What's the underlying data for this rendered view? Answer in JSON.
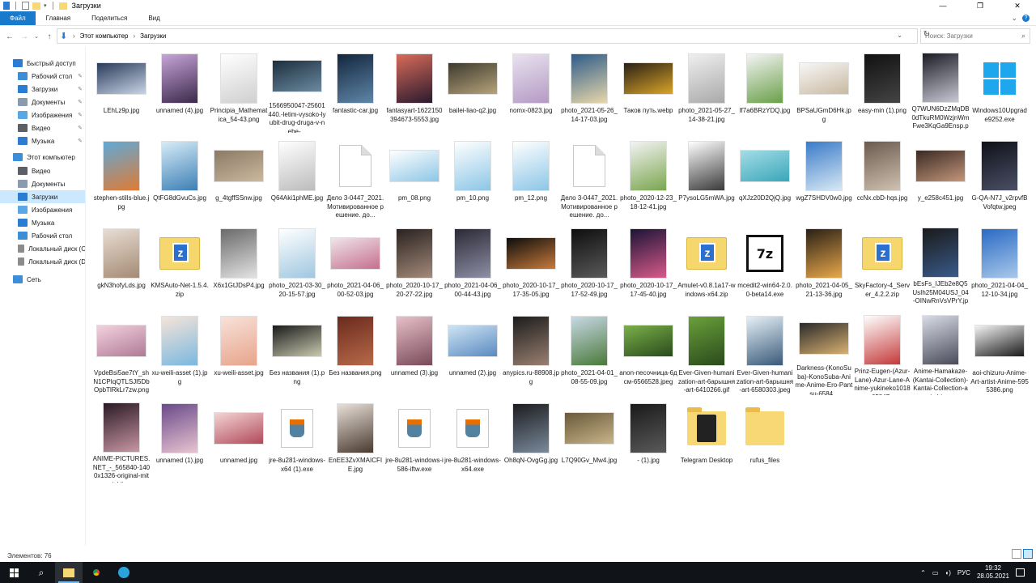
{
  "window": {
    "title": "Загрузки",
    "minimize": "—",
    "maximize": "❐",
    "close": "✕"
  },
  "ribbon": {
    "tabs": [
      "Файл",
      "Главная",
      "Поделиться",
      "Вид"
    ]
  },
  "address": {
    "crumbs": [
      "Этот компьютер",
      "Загрузки"
    ],
    "search_placeholder": "Поиск: Загрузки"
  },
  "nav": {
    "items": [
      {
        "label": "Быстрый доступ",
        "icon": "star-icon",
        "color": "#2b7cd3",
        "indent": 0,
        "pin": false
      },
      {
        "label": "Рабочий стол",
        "icon": "desktop-icon",
        "color": "#3c8fd6",
        "indent": 1,
        "pin": true
      },
      {
        "label": "Загрузки",
        "icon": "download-icon",
        "color": "#2b7cd3",
        "indent": 1,
        "pin": true
      },
      {
        "label": "Документы",
        "icon": "documents-icon",
        "color": "#8a9bb0",
        "indent": 1,
        "pin": true
      },
      {
        "label": "Изображения",
        "icon": "pictures-icon",
        "color": "#5aa7e6",
        "indent": 1,
        "pin": true
      },
      {
        "label": "Видео",
        "icon": "video-icon",
        "color": "#5b5f66",
        "indent": 1,
        "pin": true
      },
      {
        "label": "Музыка",
        "icon": "music-icon",
        "color": "#2b7cd3",
        "indent": 1,
        "pin": true
      },
      {
        "label": "Этот компьютер",
        "icon": "computer-icon",
        "color": "#3c8fd6",
        "indent": 0,
        "pin": false
      },
      {
        "label": "Видео",
        "icon": "video-icon",
        "color": "#5b5f66",
        "indent": 1,
        "pin": false
      },
      {
        "label": "Документы",
        "icon": "documents-icon",
        "color": "#8a9bb0",
        "indent": 1,
        "pin": false
      },
      {
        "label": "Загрузки",
        "icon": "download-icon",
        "color": "#2b7cd3",
        "indent": 1,
        "pin": false
      },
      {
        "label": "Изображения",
        "icon": "pictures-icon",
        "color": "#5aa7e6",
        "indent": 1,
        "pin": false
      },
      {
        "label": "Музыка",
        "icon": "music-icon",
        "color": "#2b7cd3",
        "indent": 1,
        "pin": false
      },
      {
        "label": "Рабочий стол",
        "icon": "desktop-icon",
        "color": "#3c8fd6",
        "indent": 1,
        "pin": false
      },
      {
        "label": "Локальный диск (C",
        "icon": "drive-icon",
        "color": "#8c8c8c",
        "indent": 1,
        "pin": false
      },
      {
        "label": "Локальный диск (D",
        "icon": "drive-icon",
        "color": "#8c8c8c",
        "indent": 1,
        "pin": false
      },
      {
        "label": "Сеть",
        "icon": "network-icon",
        "color": "#3c8fd6",
        "indent": 0,
        "pin": false
      }
    ],
    "selected_index": 10
  },
  "files": [
    {
      "name": "LEhLz9p.jpg",
      "kind": "img",
      "c1": "#2a3a5a",
      "c2": "#c8d4e6"
    },
    {
      "name": "unnamed (4).jpg",
      "kind": "img",
      "c1": "#c7a4d8",
      "c2": "#3b2a4a"
    },
    {
      "name": "Principia_Mathematica_54-43.png",
      "kind": "img",
      "c1": "#ffffff",
      "c2": "#cfcfcf"
    },
    {
      "name": "1566950047-25601440.-letim-vysoko-lyubit-drug-druga-v-nebe-...",
      "kind": "img",
      "c1": "#1c2f3e",
      "c2": "#6b8aa0"
    },
    {
      "name": "fantastic-car.jpg",
      "kind": "img",
      "c1": "#13263d",
      "c2": "#5f86a8"
    },
    {
      "name": "fantasyart-1622150394673-5553.jpg",
      "kind": "img",
      "c1": "#d96b5a",
      "c2": "#2a1a2e"
    },
    {
      "name": "bailei-liao-q2.jpg",
      "kind": "img",
      "c1": "#3c3a2e",
      "c2": "#b7a37a"
    },
    {
      "name": "nomx-0823.jpg",
      "kind": "img",
      "c1": "#e9e2ef",
      "c2": "#b49ac4"
    },
    {
      "name": "photo_2021-05-26_14-17-03.jpg",
      "kind": "img",
      "c1": "#2d5c8a",
      "c2": "#e8d7a9"
    },
    {
      "name": "Таков путь.webp",
      "kind": "img",
      "c1": "#2a2014",
      "c2": "#d9a42a"
    },
    {
      "name": "photo_2021-05-27_14-38-21.jpg",
      "kind": "img",
      "c1": "#efefef",
      "c2": "#a9a9a9"
    },
    {
      "name": "lf7a6BRzYDQ.jpg",
      "kind": "img",
      "c1": "#f4f4f4",
      "c2": "#6aa04a"
    },
    {
      "name": "BPSaUGmD6Hk.jpg",
      "kind": "img",
      "c1": "#f7f7f7",
      "c2": "#c9b9a0"
    },
    {
      "name": "easy-min (1).png",
      "kind": "img",
      "c1": "#111111",
      "c2": "#444444"
    },
    {
      "name": "Q7WUN6DzZMqDB0dTkuRM0WzjnWmFwe3KqGa9Ensp.png",
      "kind": "img",
      "c1": "#1b1b24",
      "c2": "#c9c9d6"
    },
    {
      "name": "Windows10Upgrade9252.exe",
      "kind": "win"
    },
    {
      "name": "stephen-stills-blue.jpg",
      "kind": "img",
      "c1": "#5fa9d8",
      "c2": "#e07b34"
    },
    {
      "name": "QtFG8dGvuCs.jpg",
      "kind": "img",
      "c1": "#d7ecf7",
      "c2": "#3c7fb5"
    },
    {
      "name": "g_4tgffSSnw.jpg",
      "kind": "img",
      "c1": "#8a7a66",
      "c2": "#cbb89e"
    },
    {
      "name": "Q64Aki1phME.jpg",
      "kind": "img",
      "c1": "#ffffff",
      "c2": "#bcbcbc"
    },
    {
      "name": "Дело 3-0447_2021. Мотивированное решение. до...",
      "kind": "doc"
    },
    {
      "name": "pm_08.png",
      "kind": "img",
      "c1": "#ffffff",
      "c2": "#8cc6e6"
    },
    {
      "name": "pm_10.png",
      "kind": "img",
      "c1": "#ffffff",
      "c2": "#8cc6e6"
    },
    {
      "name": "pm_12.png",
      "kind": "img",
      "c1": "#ffffff",
      "c2": "#8cc6e6"
    },
    {
      "name": "Дело 3-0447_2021. Мотивированное решение. до...",
      "kind": "doc"
    },
    {
      "name": "photo_2020-12-23_18-12-41.jpg",
      "kind": "img",
      "c1": "#f3f3f3",
      "c2": "#7aa64f"
    },
    {
      "name": "P7ysoLG5mWA.jpg",
      "kind": "img",
      "c1": "#ffffff",
      "c2": "#3a3a3a"
    },
    {
      "name": "qXJz20D2QjQ.jpg",
      "kind": "img",
      "c1": "#a3dde7",
      "c2": "#3aa6b8"
    },
    {
      "name": "wgZ7SHDV0w0.jpg",
      "kind": "img",
      "c1": "#3a7bc8",
      "c2": "#d8e8f5"
    },
    {
      "name": "ccNx.cbD-hqs.jpg",
      "kind": "img",
      "c1": "#6b5a4e",
      "c2": "#cfc2b2"
    },
    {
      "name": "y_e258c451.jpg",
      "kind": "img",
      "c1": "#3a2a24",
      "c2": "#c4967a"
    },
    {
      "name": "G-QA-N7J_v2rpvfBVofqtw.jpeg",
      "kind": "img",
      "c1": "#0f1118",
      "c2": "#4a4f66"
    },
    {
      "name": "gkN3hofyLds.jpg",
      "kind": "img",
      "c1": "#e8ddd3",
      "c2": "#a48a74"
    },
    {
      "name": "KMSAuto-Net-1.5.4.zip",
      "kind": "zip"
    },
    {
      "name": "X6x1GtJDsP4.jpg",
      "kind": "img",
      "c1": "#6a6a6a",
      "c2": "#e3e3e3"
    },
    {
      "name": "photo_2021-03-30_20-15-57.jpg",
      "kind": "img",
      "c1": "#ffffff",
      "c2": "#9fc7e0"
    },
    {
      "name": "photo_2021-04-06_00-52-03.jpg",
      "kind": "img",
      "c1": "#f0e4ea",
      "c2": "#c46f8e"
    },
    {
      "name": "photo_2020-10-17_20-27-22.jpg",
      "kind": "img",
      "c1": "#2a2220",
      "c2": "#a38a7a"
    },
    {
      "name": "photo_2021-04-06_00-44-43.jpg",
      "kind": "img",
      "c1": "#2a2a36",
      "c2": "#8f8fa6"
    },
    {
      "name": "photo_2020-10-17_17-35-05.jpg",
      "kind": "img",
      "c1": "#0e0e0e",
      "c2": "#c77a3a"
    },
    {
      "name": "photo_2020-10-17_17-52-49.jpg",
      "kind": "img",
      "c1": "#0e0e0e",
      "c2": "#5a5a5a"
    },
    {
      "name": "photo_2020-10-17_17-45-40.jpg",
      "kind": "img",
      "c1": "#1c1436",
      "c2": "#d85a8a"
    },
    {
      "name": "Amulet-v0.8.1a17-windows-x64.zip",
      "kind": "zip"
    },
    {
      "name": "mcedit2-win64-2.0.0-beta14.exe",
      "kind": "7z"
    },
    {
      "name": "photo_2021-04-05_21-13-36.jpg",
      "kind": "img",
      "c1": "#2a2016",
      "c2": "#e8a84a"
    },
    {
      "name": "SkyFactory-4_Server_4.2.2.zip",
      "kind": "zip"
    },
    {
      "name": "bEsFs_IJEb2e8Q5UsIh25M04USJ_04-OINwRnVsVPrY.jpg",
      "kind": "img",
      "c1": "#1a1a1a",
      "c2": "#3a5a8a"
    },
    {
      "name": "photo_2021-04-04_12-10-34.jpg",
      "kind": "img",
      "c1": "#2a6ac4",
      "c2": "#a8c8ea"
    },
    {
      "name": "VpdeBsi5ae7tY_shN1CPIqQTLSJl5DbOpbTlRkLr7zw.png",
      "kind": "img",
      "c1": "#f2d2de",
      "c2": "#b07a96"
    },
    {
      "name": "xu-weili-asset (1).jpg",
      "kind": "img",
      "c1": "#f6e4d8",
      "c2": "#7ab8e0"
    },
    {
      "name": "xu-weili-asset.jpg",
      "kind": "img",
      "c1": "#f8e2da",
      "c2": "#e7a48a"
    },
    {
      "name": "Без названия (1).png",
      "kind": "img",
      "c1": "#1a1a1a",
      "c2": "#c9c9b0"
    },
    {
      "name": "Без названия.png",
      "kind": "img",
      "c1": "#6a2a1c",
      "c2": "#b86a4a"
    },
    {
      "name": "unnamed (3).jpg",
      "kind": "img",
      "c1": "#e6c0c8",
      "c2": "#7a4a5a"
    },
    {
      "name": "unnamed (2).jpg",
      "kind": "img",
      "c1": "#cfe4f4",
      "c2": "#5a8ac0"
    },
    {
      "name": "anypics.ru-88908.jpg",
      "kind": "img",
      "c1": "#1c1c1c",
      "c2": "#9a8070"
    },
    {
      "name": "photo_2021-04-01_08-55-09.jpg",
      "kind": "img",
      "c1": "#c8d8e6",
      "c2": "#4a7a3a"
    },
    {
      "name": "anon-песочница-6дсм-6566528.jpeg",
      "kind": "img",
      "c1": "#7ab04a",
      "c2": "#2a4a1c"
    },
    {
      "name": "Ever-Given-humanization-art-6арышня-art-6410266.gif",
      "kind": "img",
      "c1": "#6aa03a",
      "c2": "#2a4a1c"
    },
    {
      "name": "Ever-Given-humanization-art-6арышня-art-6580303.jpeg",
      "kind": "img",
      "c1": "#e6f0f6",
      "c2": "#3a5a7a"
    },
    {
      "name": "Darkness-(KonoSuba)-KonoSuba-Anime-Anime-Ero-Pantsu-6584...",
      "kind": "img",
      "c1": "#2a2a2a",
      "c2": "#d8b070"
    },
    {
      "name": "Prinz-Eugen-(Azur-Lane)-Azur-Lane-Anime-yukineko1018-65847...",
      "kind": "img",
      "c1": "#ffffff",
      "c2": "#c43a3a"
    },
    {
      "name": "Anime-Hamakaze-(Kantai-Collection)-Kantai-Collection-aoi-chizu...",
      "kind": "img",
      "c1": "#d8dce6",
      "c2": "#4a4a5a"
    },
    {
      "name": "aoi-chizuru-Anime-Art-artist-Anime-5955386.png",
      "kind": "img",
      "c1": "#f4f4f4",
      "c2": "#1a1a1a"
    },
    {
      "name": "ANIME-PICTURES.NET_-_565840-1400x1326-original-mito+ichijyo-...",
      "kind": "img",
      "c1": "#2a1a24",
      "c2": "#c896a4"
    },
    {
      "name": "unnamed (1).jpg",
      "kind": "img",
      "c1": "#6a4a8a",
      "c2": "#e8c4d0"
    },
    {
      "name": "unnamed.jpg",
      "kind": "img",
      "c1": "#f4d4d4",
      "c2": "#b04a5a"
    },
    {
      "name": "jre-8u281-windows-x64 (1).exe",
      "kind": "java"
    },
    {
      "name": "EnEE3ZvXMAICFIE.jpg",
      "kind": "img",
      "c1": "#e8e0d8",
      "c2": "#4a3a30"
    },
    {
      "name": "jre-8u281-windows-i586-iftw.exe",
      "kind": "java"
    },
    {
      "name": "jre-8u281-windows-x64.exe",
      "kind": "java"
    },
    {
      "name": "Oh8qN-OvgGg.jpg",
      "kind": "img",
      "c1": "#1c1c20",
      "c2": "#7a8a9a"
    },
    {
      "name": "L7Q90Gv_Mw4.jpg",
      "kind": "img",
      "c1": "#6a5a3a",
      "c2": "#c8b48a"
    },
    {
      "name": "- (1).jpg",
      "kind": "img",
      "c1": "#1a1a1a",
      "c2": "#5a5a5a"
    },
    {
      "name": "Telegram Desktop",
      "kind": "folder-tg"
    },
    {
      "name": "rufus_files",
      "kind": "folder"
    }
  ],
  "status": {
    "count": "Элементов: 76"
  },
  "taskbar": {
    "lang": "РУС",
    "time": "19:32",
    "date": "28.05.2021"
  }
}
